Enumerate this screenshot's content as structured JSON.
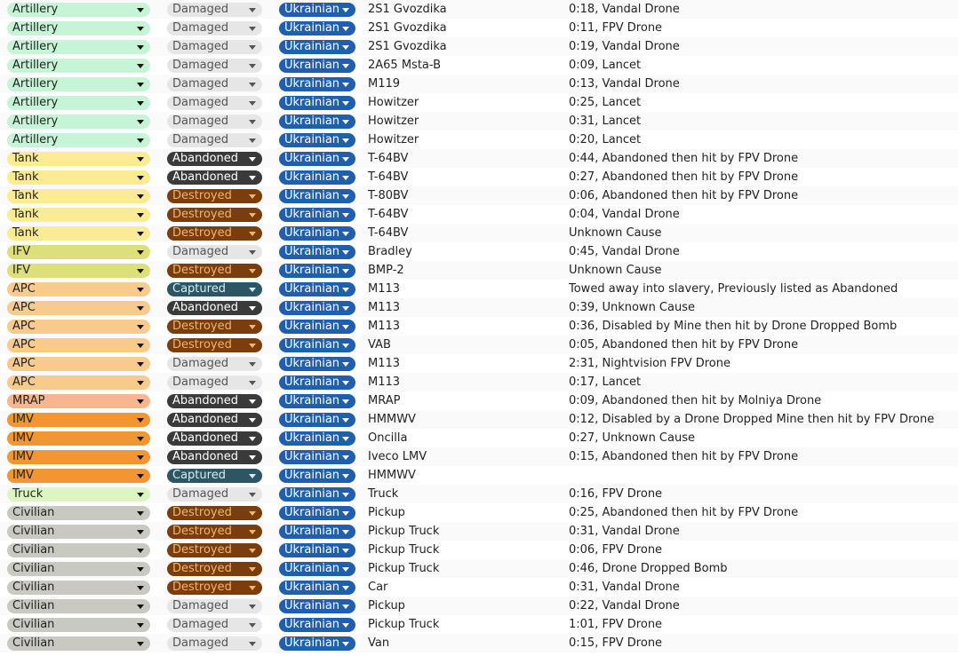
{
  "type_colors": {
    "Artillery": {
      "bg": "#c6f4d6",
      "fg": "#222222"
    },
    "Tank": {
      "bg": "#fbeb92",
      "fg": "#222222"
    },
    "IFV": {
      "bg": "#dde07a",
      "fg": "#222222"
    },
    "APC": {
      "bg": "#f8ca8c",
      "fg": "#222222"
    },
    "MRAP": {
      "bg": "#f7b68e",
      "fg": "#222222"
    },
    "IMV": {
      "bg": "#f29633",
      "fg": "#222222"
    },
    "Truck": {
      "bg": "#dcf6c2",
      "fg": "#222222"
    },
    "Civilian": {
      "bg": "#c9c9c2",
      "fg": "#222222"
    }
  },
  "status_colors": {
    "Damaged": {
      "bg": "#e6e6e6",
      "fg": "#555555"
    },
    "Abandoned": {
      "bg": "#3a3a3a",
      "fg": "#ffffff"
    },
    "Destroyed": {
      "bg": "#7a3d0e",
      "fg": "#f2b46e"
    },
    "Captured": {
      "bg": "#2c5664",
      "fg": "#d6eef3"
    }
  },
  "nationality_color": {
    "bg": "#1f5fae",
    "fg": "#ffffff"
  },
  "rows": [
    {
      "type": "Artillery",
      "status": "Damaged",
      "nationality": "Ukrainian",
      "model": "2S1 Gvozdika",
      "notes": "0:18, Vandal Drone"
    },
    {
      "type": "Artillery",
      "status": "Damaged",
      "nationality": "Ukrainian",
      "model": "2S1 Gvozdika",
      "notes": "0:11, FPV Drone"
    },
    {
      "type": "Artillery",
      "status": "Damaged",
      "nationality": "Ukrainian",
      "model": "2S1 Gvozdika",
      "notes": "0:19, Vandal Drone"
    },
    {
      "type": "Artillery",
      "status": "Damaged",
      "nationality": "Ukrainian",
      "model": "2A65 Msta-B",
      "notes": "0:09, Lancet"
    },
    {
      "type": "Artillery",
      "status": "Damaged",
      "nationality": "Ukrainian",
      "model": "M119",
      "notes": "0:13, Vandal Drone"
    },
    {
      "type": "Artillery",
      "status": "Damaged",
      "nationality": "Ukrainian",
      "model": "Howitzer",
      "notes": "0:25, Lancet"
    },
    {
      "type": "Artillery",
      "status": "Damaged",
      "nationality": "Ukrainian",
      "model": "Howitzer",
      "notes": "0:31, Lancet"
    },
    {
      "type": "Artillery",
      "status": "Damaged",
      "nationality": "Ukrainian",
      "model": "Howitzer",
      "notes": "0:20, Lancet"
    },
    {
      "type": "Tank",
      "status": "Abandoned",
      "nationality": "Ukrainian",
      "model": "T-64BV",
      "notes": "0:44, Abandoned then hit by FPV Drone"
    },
    {
      "type": "Tank",
      "status": "Abandoned",
      "nationality": "Ukrainian",
      "model": "T-64BV",
      "notes": "0:27, Abandoned then hit by FPV Drone"
    },
    {
      "type": "Tank",
      "status": "Destroyed",
      "nationality": "Ukrainian",
      "model": "T-80BV",
      "notes": "0:06, Abandoned then hit by FPV Drone"
    },
    {
      "type": "Tank",
      "status": "Destroyed",
      "nationality": "Ukrainian",
      "model": "T-64BV",
      "notes": "0:04, Vandal Drone"
    },
    {
      "type": "Tank",
      "status": "Destroyed",
      "nationality": "Ukrainian",
      "model": "T-64BV",
      "notes": "Unknown Cause"
    },
    {
      "type": "IFV",
      "status": "Damaged",
      "nationality": "Ukrainian",
      "model": "Bradley",
      "notes": "0:45, Vandal Drone"
    },
    {
      "type": "IFV",
      "status": "Destroyed",
      "nationality": "Ukrainian",
      "model": "BMP-2",
      "notes": "Unknown Cause"
    },
    {
      "type": "APC",
      "status": "Captured",
      "nationality": "Ukrainian",
      "model": "M113",
      "notes": "Towed away into slavery, Previously listed as Abandoned"
    },
    {
      "type": "APC",
      "status": "Abandoned",
      "nationality": "Ukrainian",
      "model": "M113",
      "notes": "0:39, Unknown Cause"
    },
    {
      "type": "APC",
      "status": "Destroyed",
      "nationality": "Ukrainian",
      "model": "M113",
      "notes": "0:36, Disabled by Mine then hit by Drone Dropped Bomb"
    },
    {
      "type": "APC",
      "status": "Destroyed",
      "nationality": "Ukrainian",
      "model": "VAB",
      "notes": "0:05, Abandoned then hit by FPV Drone"
    },
    {
      "type": "APC",
      "status": "Damaged",
      "nationality": "Ukrainian",
      "model": "M113",
      "notes": "2:31, Nightvision FPV Drone"
    },
    {
      "type": "APC",
      "status": "Damaged",
      "nationality": "Ukrainian",
      "model": "M113",
      "notes": "0:17, Lancet"
    },
    {
      "type": "MRAP",
      "status": "Abandoned",
      "nationality": "Ukrainian",
      "model": "MRAP",
      "notes": "0:09, Abandoned then hit by Molniya Drone"
    },
    {
      "type": "IMV",
      "status": "Abandoned",
      "nationality": "Ukrainian",
      "model": "HMMWV",
      "notes": "0:12, Disabled by a Drone Dropped Mine then hit by FPV Drone"
    },
    {
      "type": "IMV",
      "status": "Abandoned",
      "nationality": "Ukrainian",
      "model": "Oncilla",
      "notes": "0:27, Unknown Cause"
    },
    {
      "type": "IMV",
      "status": "Abandoned",
      "nationality": "Ukrainian",
      "model": "Iveco LMV",
      "notes": "0:15, Abandoned then hit by FPV Drone"
    },
    {
      "type": "IMV",
      "status": "Captured",
      "nationality": "Ukrainian",
      "model": "HMMWV",
      "notes": ""
    },
    {
      "type": "Truck",
      "status": "Damaged",
      "nationality": "Ukrainian",
      "model": "Truck",
      "notes": "0:16, FPV Drone"
    },
    {
      "type": "Civilian",
      "status": "Destroyed",
      "nationality": "Ukrainian",
      "model": "Pickup",
      "notes": "0:25, Abandoned then hit by FPV Drone"
    },
    {
      "type": "Civilian",
      "status": "Destroyed",
      "nationality": "Ukrainian",
      "model": "Pickup Truck",
      "notes": "0:31, Vandal Drone"
    },
    {
      "type": "Civilian",
      "status": "Destroyed",
      "nationality": "Ukrainian",
      "model": "Pickup Truck",
      "notes": "0:06, FPV Drone"
    },
    {
      "type": "Civilian",
      "status": "Destroyed",
      "nationality": "Ukrainian",
      "model": "Pickup Truck",
      "notes": "0:46, Drone Dropped Bomb"
    },
    {
      "type": "Civilian",
      "status": "Destroyed",
      "nationality": "Ukrainian",
      "model": "Car",
      "notes": "0:31, Vandal Drone"
    },
    {
      "type": "Civilian",
      "status": "Damaged",
      "nationality": "Ukrainian",
      "model": "Pickup",
      "notes": "0:22, Vandal Drone"
    },
    {
      "type": "Civilian",
      "status": "Damaged",
      "nationality": "Ukrainian",
      "model": "Pickup Truck",
      "notes": "1:01, FPV Drone"
    },
    {
      "type": "Civilian",
      "status": "Damaged",
      "nationality": "Ukrainian",
      "model": "Van",
      "notes": "0:15, FPV Drone"
    }
  ]
}
